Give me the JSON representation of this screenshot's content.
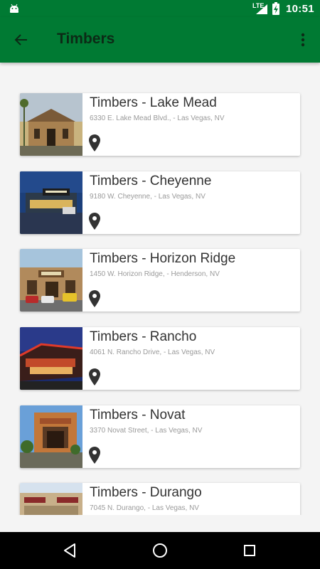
{
  "status_bar": {
    "network": "LTE",
    "time": "10:51"
  },
  "app_bar": {
    "title": "Timbers"
  },
  "locations": [
    {
      "name": "Timbers - Lake Mead",
      "address": "6330 E. Lake Mead Blvd., - Las Vegas, NV"
    },
    {
      "name": "Timbers - Cheyenne",
      "address": "9180 W. Cheyenne, - Las Vegas, NV"
    },
    {
      "name": "Timbers - Horizon Ridge",
      "address": "1450 W. Horizon Ridge, - Henderson, NV"
    },
    {
      "name": "Timbers - Rancho",
      "address": "4061 N. Rancho Drive, - Las Vegas, NV"
    },
    {
      "name": "Timbers - Novat",
      "address": "3370 Novat Street, - Las Vegas, NV"
    },
    {
      "name": "Timbers - Durango",
      "address": "7045 N. Durango, - Las Vegas, NV"
    }
  ],
  "icons": {
    "back": "arrow-back-icon",
    "overflow": "more-vert-icon",
    "pin": "map-pin-icon",
    "nav_back": "triangle-back-icon",
    "nav_home": "circle-home-icon",
    "nav_recents": "square-recents-icon"
  },
  "colors": {
    "primary": "#007a33",
    "title_text": "#0c2a16",
    "background": "#f4f4f4"
  }
}
